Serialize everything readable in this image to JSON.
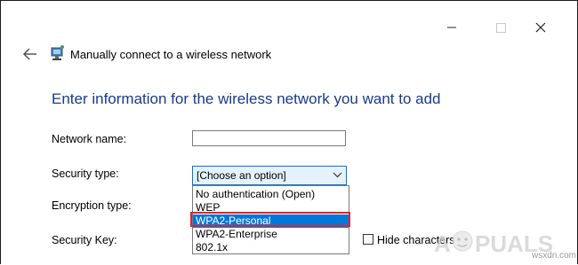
{
  "titlebar": {
    "minimize_icon": "minimize-icon",
    "maximize_icon": "maximize-icon",
    "close_icon": "close-icon"
  },
  "nav": {
    "back_icon": "back-arrow-icon",
    "network_icon": "network-icon",
    "title": "Manually connect to a wireless network"
  },
  "main": {
    "heading": "Enter information for the wireless network you want to add",
    "fields": {
      "network_name_label": "Network name:",
      "network_name_value": "",
      "security_type_label": "Security type:",
      "security_type_value": "[Choose an option]",
      "encryption_type_label": "Encryption type:",
      "security_key_label": "Security Key:",
      "hide_characters_label": "Hide characters",
      "hide_characters_checked": false
    },
    "security_options": [
      "No authentication (Open)",
      "WEP",
      "WPA2-Personal",
      "WPA2-Enterprise",
      "802.1x"
    ],
    "highlighted_option": "WPA2-Personal"
  },
  "watermark": {
    "logo_text": "A PUALS",
    "site": "wsxdn.com"
  },
  "colors": {
    "heading": "#1a3a8c",
    "selection": "#0078d7",
    "highlight_border": "#d9262d"
  }
}
